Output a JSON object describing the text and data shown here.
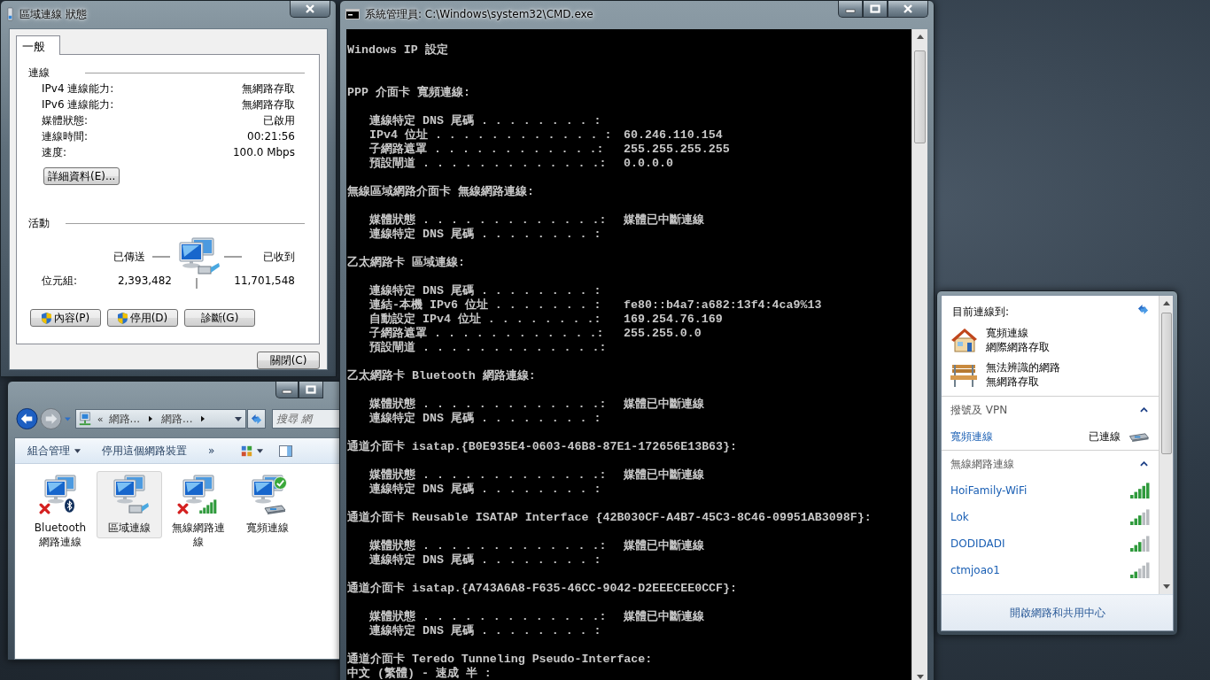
{
  "status_dialog": {
    "title": "區域連線 狀態",
    "tabs": [
      {
        "label": "一般",
        "selected": true
      }
    ],
    "connection": {
      "heading": "連線",
      "rows": [
        {
          "label": "IPv4 連線能力:",
          "value": "無網路存取"
        },
        {
          "label": "IPv6 連線能力:",
          "value": "無網路存取"
        },
        {
          "label": "媒體狀態:",
          "value": "已啟用"
        },
        {
          "label": "連線時間:",
          "value": "00:21:56"
        },
        {
          "label": "速度:",
          "value": "100.0 Mbps"
        }
      ],
      "details_button": "詳細資料(E)..."
    },
    "activity": {
      "heading": "活動",
      "sent_label": "已傳送",
      "received_label": "已收到",
      "bytes_label": "位元組:",
      "bytes_sent": "2,393,482",
      "bytes_received": "11,701,548"
    },
    "buttons": [
      {
        "label": "內容(P)",
        "shield": true
      },
      {
        "label": "停用(D)",
        "shield": true
      },
      {
        "label": "診斷(G)",
        "shield": false
      }
    ],
    "close_button": "關閉(C)"
  },
  "explorer": {
    "address": {
      "overflow": "«",
      "breadcrumbs": [
        "網路...",
        "網路..."
      ]
    },
    "search": {
      "placeholder": "搜尋 網"
    },
    "toolbar": [
      {
        "label": "組合管理",
        "dropdown": true
      },
      {
        "label": "停用這個網路裝置",
        "dropdown": false
      }
    ],
    "more": "»",
    "items": [
      {
        "label": "Bluetooth 網路連線",
        "kind": "bluetooth",
        "disconnected": true,
        "connected": false,
        "selected": false
      },
      {
        "label": "區域連線",
        "kind": "lan",
        "disconnected": false,
        "connected": false,
        "selected": true
      },
      {
        "label": "無線網路連線",
        "kind": "wireless",
        "disconnected": true,
        "connected": false,
        "selected": false
      },
      {
        "label": "寬頻連線",
        "kind": "broadband",
        "disconnected": false,
        "connected": true,
        "selected": false
      }
    ]
  },
  "cmd": {
    "title": "系統管理員: C:\\Windows\\system32\\CMD.exe",
    "intro": "Windows IP 設定",
    "sections": [
      {
        "heading": "PPP 介面卡 寬頻連線:",
        "entries": [
          {
            "label": "連線特定 DNS 尾碼 . . . . . . . . :"
          },
          {
            "label": "IPv4 位址 . . . . . . . . . . . . :",
            "value": "60.246.110.154"
          },
          {
            "label": "子網路遮罩 . . . . . . . . . . . .:",
            "value": "255.255.255.255"
          },
          {
            "label": "預設閘道 . . . . . . . . . . . . .:",
            "value": "0.0.0.0"
          }
        ]
      },
      {
        "heading": "無線區域網路介面卡 無線網路連線:",
        "entries": [
          {
            "label": "媒體狀態 . . . . . . . . . . . . .:",
            "value": "媒體已中斷連線"
          },
          {
            "label": "連線特定 DNS 尾碼 . . . . . . . . :"
          }
        ]
      },
      {
        "heading": "乙太網路卡 區域連線:",
        "entries": [
          {
            "label": "連線特定 DNS 尾碼 . . . . . . . . :"
          },
          {
            "label": "連結-本機 IPv6 位址 . . . . . . . :",
            "value": "fe80::b4a7:a682:13f4:4ca9%13"
          },
          {
            "label": "自動設定 IPv4 位址 . . . . . . . .:",
            "value": "169.254.76.169"
          },
          {
            "label": "子網路遮罩 . . . . . . . . . . . .:",
            "value": "255.255.0.0"
          },
          {
            "label": "預設閘道 . . . . . . . . . . . . .:"
          }
        ]
      },
      {
        "heading": "乙太網路卡 Bluetooth 網路連線:",
        "entries": [
          {
            "label": "媒體狀態 . . . . . . . . . . . . .:",
            "value": "媒體已中斷連線"
          },
          {
            "label": "連線特定 DNS 尾碼 . . . . . . . . :"
          }
        ]
      },
      {
        "heading": "通道介面卡 isatap.{B0E935E4-0603-46B8-87E1-172656E13B63}:",
        "entries": [
          {
            "label": "媒體狀態 . . . . . . . . . . . . .:",
            "value": "媒體已中斷連線"
          },
          {
            "label": "連線特定 DNS 尾碼 . . . . . . . . :"
          }
        ]
      },
      {
        "heading": "通道介面卡 Reusable ISATAP Interface {42B030CF-A4B7-45C3-8C46-09951AB3098F}:",
        "entries": [
          {
            "label": "媒體狀態 . . . . . . . . . . . . .:",
            "value": "媒體已中斷連線"
          },
          {
            "label": "連線特定 DNS 尾碼 . . . . . . . . :"
          }
        ]
      },
      {
        "heading": "通道介面卡 isatap.{A743A6A8-F635-46CC-9042-D2EEECEE0CCF}:",
        "entries": [
          {
            "label": "媒體狀態 . . . . . . . . . . . . .:",
            "value": "媒體已中斷連線"
          },
          {
            "label": "連線特定 DNS 尾碼 . . . . . . . . :"
          }
        ]
      },
      {
        "heading": "通道介面卡 Teredo Tunneling Pseudo-Interface:"
      }
    ],
    "ime": "中文 (繁體) - 速成 半 :"
  },
  "network_flyout": {
    "header": "目前連線到:",
    "connections": [
      {
        "name": "寬頻連線",
        "status": "網際網路存取",
        "kind": "house"
      },
      {
        "name": "無法辨識的網路",
        "status": "無網路存取",
        "kind": "bench"
      }
    ],
    "dialup": {
      "heading": "撥號及 VPN",
      "expanded": true,
      "items": [
        {
          "name": "寬頻連線",
          "status": "已連線"
        }
      ]
    },
    "wireless": {
      "heading": "無線網路連線",
      "expanded": true,
      "networks": [
        {
          "name": "HoiFamily-WiFi",
          "kind": "strong"
        },
        {
          "name": "Lok",
          "kind": "medium"
        },
        {
          "name": "DODIDADI",
          "kind": "medium"
        },
        {
          "name": "ctmjoao1",
          "kind": "weak"
        }
      ]
    },
    "footer_link": "開啟網路和共用中心"
  }
}
